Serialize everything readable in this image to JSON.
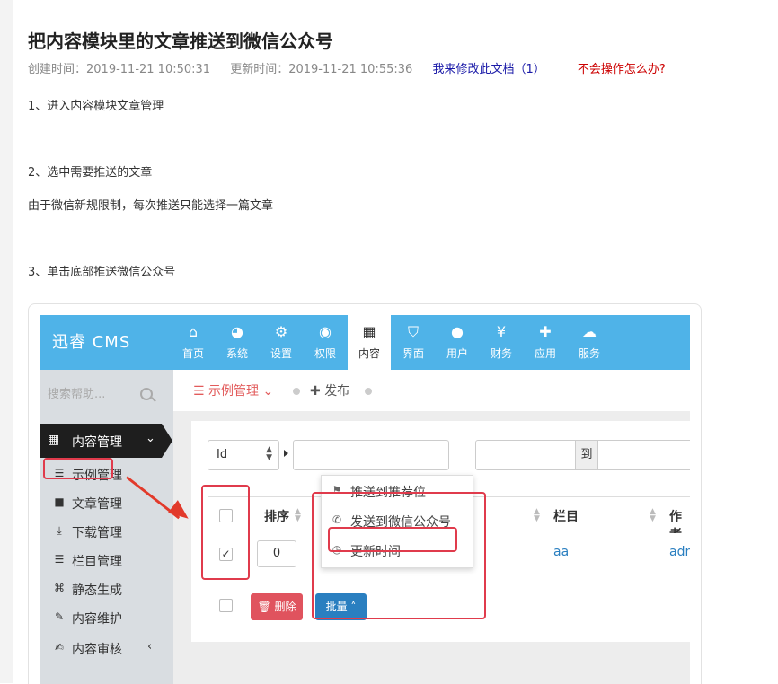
{
  "doc": {
    "title": "把内容模块里的文章推送到微信公众号",
    "created": "创建时间：2019-11-21 10:50:31",
    "updated": "更新时间：2019-11-21 10:55:36",
    "edit_link": "我来修改此文档（1）",
    "help_link": "不会操作怎么办?",
    "steps": [
      "1、进入内容模块文章管理",
      "2、选中需要推送的文章",
      "由于微信新规限制，每次推送只能选择一篇文章",
      "3、单击底部推送微信公众号"
    ]
  },
  "app": {
    "logo": "迅睿 CMS",
    "nav": [
      {
        "icon": "home-icon",
        "glyph": "⌂",
        "label": "首页"
      },
      {
        "icon": "globe-icon",
        "glyph": "◕",
        "label": "系统"
      },
      {
        "icon": "gears-icon",
        "glyph": "⚙",
        "label": "设置"
      },
      {
        "icon": "user-circle-icon",
        "glyph": "◉",
        "label": "权限"
      },
      {
        "icon": "grid-icon",
        "glyph": "▦",
        "label": "内容"
      },
      {
        "icon": "html5-icon",
        "glyph": "⛉",
        "label": "界面"
      },
      {
        "icon": "user-icon",
        "glyph": "●",
        "label": "用户"
      },
      {
        "icon": "yen-icon",
        "glyph": "¥",
        "label": "财务"
      },
      {
        "icon": "puzzle-icon",
        "glyph": "✚",
        "label": "应用"
      },
      {
        "icon": "cloud-icon",
        "glyph": "☁",
        "label": "服务"
      }
    ],
    "active_nav": "内容",
    "search_placeholder": "搜索帮助...",
    "sidebar": {
      "head": "内容管理",
      "items": [
        {
          "icon": "list-icon",
          "glyph": "☰",
          "label": "示例管理"
        },
        {
          "icon": "file-icon",
          "glyph": "■",
          "label": "文章管理"
        },
        {
          "icon": "download-icon",
          "glyph": "⤓",
          "label": "下载管理"
        },
        {
          "icon": "list-icon",
          "glyph": "☰",
          "label": "栏目管理"
        },
        {
          "icon": "file-code-icon",
          "glyph": "⌘",
          "label": "静态生成"
        },
        {
          "icon": "wrench-icon",
          "glyph": "✎",
          "label": "内容维护"
        },
        {
          "icon": "edit-icon",
          "glyph": "✍",
          "label": "内容审核"
        }
      ]
    },
    "crumbs": {
      "current": "示例管理",
      "publish": "发布"
    },
    "filter": {
      "field": "Id",
      "to": "到"
    },
    "table": {
      "headers": {
        "order": "排序",
        "column": "栏目",
        "author": "作者"
      },
      "row": {
        "order": "0",
        "column": "aa",
        "author": "adm"
      }
    },
    "dropdown": [
      {
        "icon": "flag-icon",
        "glyph": "⚑",
        "label": "推送到推荐位"
      },
      {
        "icon": "wechat-icon",
        "glyph": "✆",
        "label": "发送到微信公众号"
      },
      {
        "icon": "clock-icon",
        "glyph": "◷",
        "label": "更新时间"
      }
    ],
    "buttons": {
      "delete": "删除",
      "batch": "批量"
    },
    "colors": {
      "nav": "#4fb3e8",
      "danger": "#e0535e",
      "primary": "#2a7fc0",
      "highlight": "#e03b4c"
    }
  }
}
